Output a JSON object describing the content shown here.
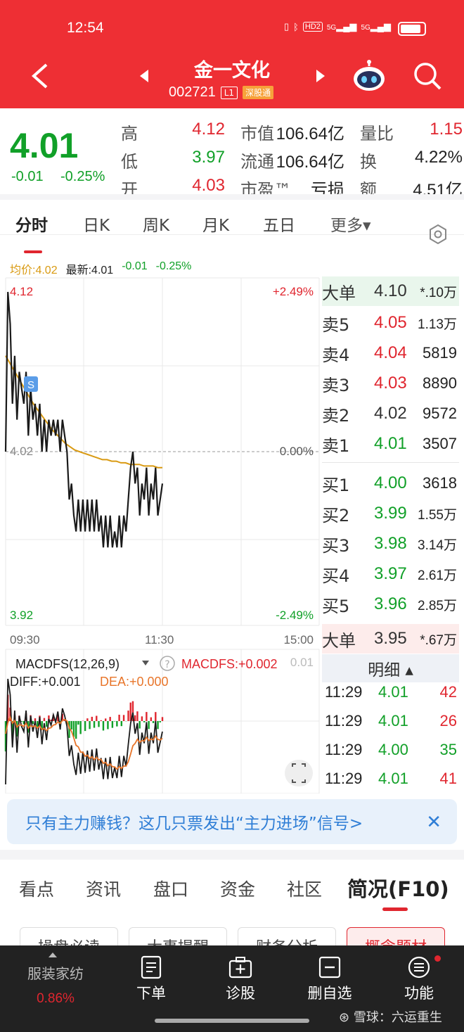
{
  "status": {
    "time": "12:54",
    "hd": "HD2",
    "sig1": "5G",
    "sig2": "5G"
  },
  "header": {
    "name": "金一文化",
    "code": "002721",
    "tag_level": "L1",
    "tag_market": "深股通"
  },
  "quote": {
    "price": "4.01",
    "change": "-0.01",
    "change_pct": "-0.25%",
    "high_label": "高",
    "high": "4.12",
    "low_label": "低",
    "low": "3.97",
    "open_label": "开",
    "open": "4.03",
    "mktcap_label": "市值",
    "mktcap": "106.64亿",
    "float_label": "流通",
    "float": "106.64亿",
    "pe_label": "市盈™",
    "pe": "亏损",
    "volratio_label": "量比",
    "volratio": "1.15",
    "turnover_label": "换",
    "turnover": "4.22%",
    "amount_label": "额",
    "amount": "4.51亿"
  },
  "tabs": [
    "分时",
    "日K",
    "周K",
    "月K",
    "五日",
    "更多▾"
  ],
  "intraday": {
    "avg_label": "均价:4.02",
    "last_label": "最新:4.01",
    "chg": "-0.01",
    "chg_pct": "-0.25%",
    "y_top": "4.12",
    "y_mid": "4.02",
    "y_bot": "3.92",
    "pct_top": "+2.49%",
    "pct_mid": "0.00%",
    "pct_bot": "-2.49%",
    "t_start": "09:30",
    "t_mid": "11:30",
    "t_end": "15:00",
    "marker": "S"
  },
  "macd": {
    "title": "MACDFS(12,26,9)",
    "help": "?",
    "value_label": "MACDFS:+0.002",
    "diff_label": "DIFF:+0.001",
    "dea_label": "DEA:+0.000",
    "right_val": "0.01"
  },
  "chart_data": {
    "type": "line",
    "title": "",
    "ylim": [
      3.92,
      4.12
    ],
    "x_ticks": [
      "09:30",
      "11:30",
      "15:00"
    ],
    "series": [
      {
        "name": "最新",
        "values": [
          4.02,
          4.12,
          4.1,
          4.05,
          4.08,
          4.04,
          4.07,
          4.06,
          4.05,
          4.07,
          4.03,
          4.06,
          4.04,
          4.05,
          4.03,
          4.05,
          4.02,
          4.04,
          4.02,
          4.04,
          4.03,
          4.04,
          4.03,
          4.04,
          4.02,
          4.04,
          4.03,
          4.02,
          3.99,
          4.0,
          3.98,
          3.97,
          3.99,
          3.97,
          3.99,
          3.97,
          3.99,
          3.97,
          3.99,
          3.97,
          3.99,
          3.97,
          3.98,
          3.96,
          3.98,
          3.96,
          3.98,
          3.96,
          3.97,
          3.96,
          3.98,
          3.96,
          3.98,
          3.97,
          3.99,
          4.01,
          4.02,
          4.0,
          4.01,
          3.98,
          4.0,
          3.99,
          4.01,
          3.98,
          4.0,
          3.99,
          4.01,
          3.98,
          3.99,
          4.0
        ]
      },
      {
        "name": "均价",
        "values": [
          4.08,
          4.075,
          4.07,
          4.065,
          4.06,
          4.055,
          4.05,
          4.046,
          4.042,
          4.038,
          4.034,
          4.031,
          4.028,
          4.025,
          4.023,
          4.021,
          4.02,
          4.019,
          4.018,
          4.017,
          4.016,
          4.015,
          4.015,
          4.014,
          4.014,
          4.013,
          4.013,
          4.012,
          4.012,
          4.012,
          4.011,
          4.011,
          4.011,
          4.01,
          4.01
        ]
      }
    ]
  },
  "orderbook": {
    "big_sell_label": "大单",
    "big_sell_price": "4.10",
    "big_sell_vol": "*.10万",
    "asks": [
      {
        "label": "卖5",
        "price": "4.05",
        "vol": "1.13万"
      },
      {
        "label": "卖4",
        "price": "4.04",
        "vol": "5819"
      },
      {
        "label": "卖3",
        "price": "4.03",
        "vol": "8890"
      },
      {
        "label": "卖2",
        "price": "4.02",
        "vol": "9572"
      },
      {
        "label": "卖1",
        "price": "4.01",
        "vol": "3507"
      }
    ],
    "bids": [
      {
        "label": "买1",
        "price": "4.00",
        "vol": "3618"
      },
      {
        "label": "买2",
        "price": "3.99",
        "vol": "1.55万"
      },
      {
        "label": "买3",
        "price": "3.98",
        "vol": "3.14万"
      },
      {
        "label": "买4",
        "price": "3.97",
        "vol": "2.61万"
      },
      {
        "label": "买5",
        "price": "3.96",
        "vol": "2.85万"
      }
    ],
    "big_buy_label": "大单",
    "big_buy_price": "3.95",
    "big_buy_vol": "*.67万"
  },
  "detail": {
    "title": "明细 ▴",
    "rows": [
      {
        "t": "11:29",
        "p": "4.01",
        "v": "42"
      },
      {
        "t": "11:29",
        "p": "4.01",
        "v": "26"
      },
      {
        "t": "11:29",
        "p": "4.00",
        "v": "35"
      },
      {
        "t": "11:29",
        "p": "4.01",
        "v": "41"
      }
    ]
  },
  "banner": {
    "text": "只有主力赚钱？这几只票发出“主力进场”信号>",
    "close": "✕"
  },
  "ftabs": [
    "看点",
    "资讯",
    "盘口",
    "资金",
    "社区",
    "简况(F10)"
  ],
  "subtabs": [
    "操盘必读",
    "大事提醒",
    "财务分析",
    "概念题材"
  ],
  "bottom": {
    "sector": "服装家纺",
    "sector_pct": "0.86%",
    "nav": [
      "下单",
      "诊股",
      "删自选",
      "功能"
    ],
    "watermark": "雪球：六运重生"
  },
  "colors": {
    "up": "#e0262f",
    "down": "#11a028",
    "header": "#ee2f34",
    "avg": "#d99a12"
  }
}
